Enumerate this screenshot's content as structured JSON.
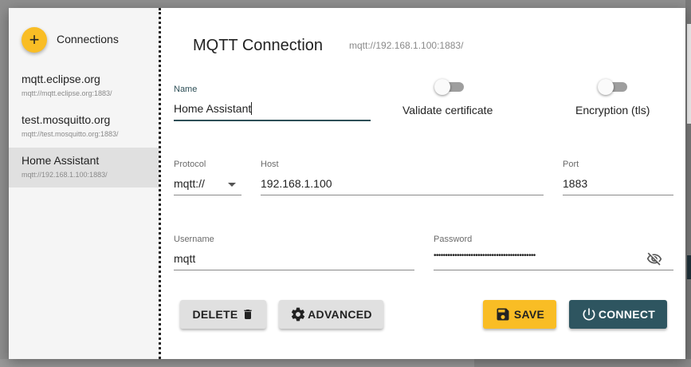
{
  "sidebar": {
    "add_icon": "plus-icon",
    "add_glyph": "+",
    "title": "Connections",
    "items": [
      {
        "name": "mqtt.eclipse.org",
        "url": "mqtt://mqtt.eclipse.org:1883/",
        "selected": false
      },
      {
        "name": "test.mosquitto.org",
        "url": "mqtt://test.mosquitto.org:1883/",
        "selected": false
      },
      {
        "name": "Home Assistant",
        "url": "mqtt://192.168.1.100:1883/",
        "selected": true
      }
    ]
  },
  "header": {
    "title": "MQTT Connection",
    "url": "mqtt://192.168.1.100:1883/"
  },
  "form": {
    "name": {
      "label": "Name",
      "value": "Home Assistant"
    },
    "validate_certificate": {
      "label": "Validate certificate",
      "checked": false
    },
    "encryption": {
      "label": "Encryption (tls)",
      "checked": false
    },
    "protocol": {
      "label": "Protocol",
      "value": "mqtt://"
    },
    "host": {
      "label": "Host",
      "value": "192.168.1.100"
    },
    "port": {
      "label": "Port",
      "value": "1883"
    },
    "username": {
      "label": "Username",
      "value": "mqtt"
    },
    "password": {
      "label": "Password",
      "value": "••••••••••••••••••••••••••••••••••••••••••••",
      "visibility_icon": "visibility-off-icon"
    }
  },
  "actions": {
    "delete": {
      "label": "DELETE",
      "icon": "trash-icon"
    },
    "advanced": {
      "label": "ADVANCED",
      "icon": "gear-icon"
    },
    "save": {
      "label": "SAVE",
      "icon": "floppy-disk-icon"
    },
    "connect": {
      "label": "CONNECT",
      "icon": "power-icon"
    }
  },
  "colors": {
    "accent": "#f9bd25",
    "primary": "#2e5560",
    "selected_item": "#e0e0e0"
  }
}
